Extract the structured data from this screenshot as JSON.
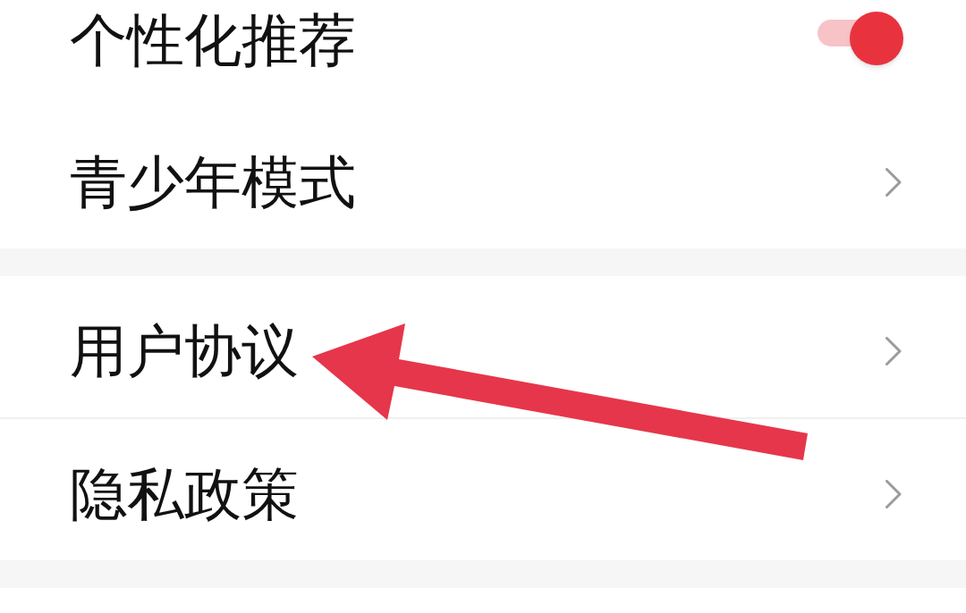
{
  "sections": [
    {
      "items": [
        {
          "label": "个性化推荐",
          "kind": "toggle",
          "on": true,
          "divider_below": false
        },
        {
          "label": "青少年模式",
          "kind": "link",
          "divider_below": false
        }
      ]
    },
    {
      "items": [
        {
          "label": "用户协议",
          "kind": "link",
          "divider_below": true
        },
        {
          "label": "隐私政策",
          "kind": "link",
          "divider_below": false
        }
      ]
    }
  ],
  "overlay": {
    "kind": "arrow"
  }
}
